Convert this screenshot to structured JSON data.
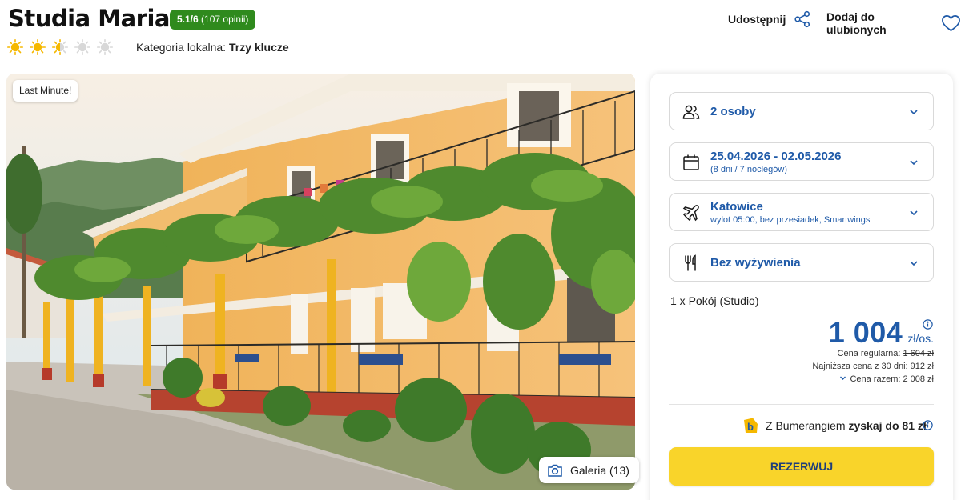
{
  "header": {
    "title": "Studia Maria",
    "rating_score": "5.1/6",
    "rating_count": "(107 opinii)",
    "stars_full": 2,
    "stars_half": 1,
    "stars_max": 5,
    "category_label": "Kategoria lokalna:",
    "category_value": "Trzy klucze",
    "share_label": "Udostępnij",
    "favorite_label": "Dodaj do ulubionych"
  },
  "photo": {
    "tag": "Last Minute!",
    "gallery_label": "Galeria (13)"
  },
  "booking": {
    "persons": "2 osoby",
    "dates": "25.04.2026 - 02.05.2026",
    "dates_sub": "(8 dni / 7 noclegów)",
    "departure_city": "Katowice",
    "departure_sub": "wylot 05:00, bez przesiadek, Smartwings",
    "board": "Bez wyżywienia",
    "room": "1 x Pokój  (Studio)",
    "price_amount": "1 004",
    "price_unit": "zł/os.",
    "regular_price_label": "Cena regularna:",
    "regular_price_value": "1 604 zł",
    "lowest_price": "Najniższa cena z 30 dni: 912 zł",
    "total_price": "Cena razem: 2 008 zł",
    "bumerang_prefix": "Z Bumerangiem",
    "bumerang_gain": "zyskaj do 81 zł",
    "reserve_label": "REZERWUJ"
  },
  "colors": {
    "accent_blue": "#1f5aa8",
    "rating_green": "#2f8a1d",
    "reserve_yellow": "#f9d42a",
    "sun_active": "#f5b800",
    "sun_inactive": "#d8d8d8"
  }
}
